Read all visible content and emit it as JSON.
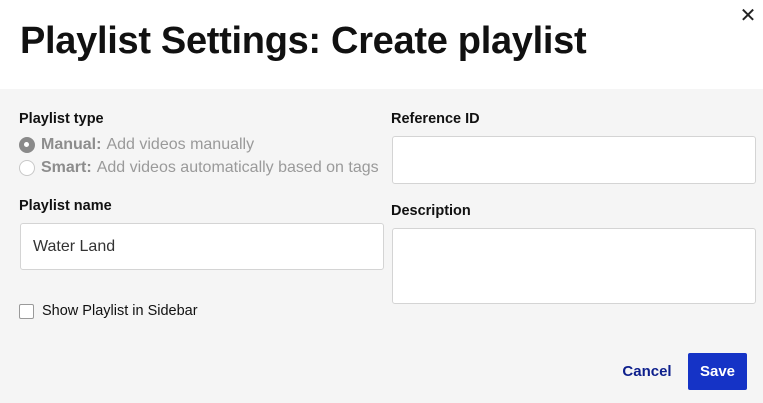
{
  "dialog": {
    "title": "Playlist Settings: Create playlist",
    "close_icon": "close-icon"
  },
  "playlist_type": {
    "label": "Playlist type",
    "options": [
      {
        "name": "Manual:",
        "description": "Add videos manually",
        "selected": true
      },
      {
        "name": "Smart:",
        "description": "Add videos automatically based on tags",
        "selected": false
      }
    ]
  },
  "playlist_name": {
    "label": "Playlist name",
    "value": "Water Land"
  },
  "reference_id": {
    "label": "Reference ID",
    "value": ""
  },
  "description": {
    "label": "Description",
    "value": ""
  },
  "sidebar_option": {
    "label": "Show Playlist in Sidebar",
    "checked": false
  },
  "actions": {
    "cancel_label": "Cancel",
    "save_label": "Save"
  },
  "colors": {
    "primary": "#1533c6",
    "link": "#0d1f8c"
  }
}
